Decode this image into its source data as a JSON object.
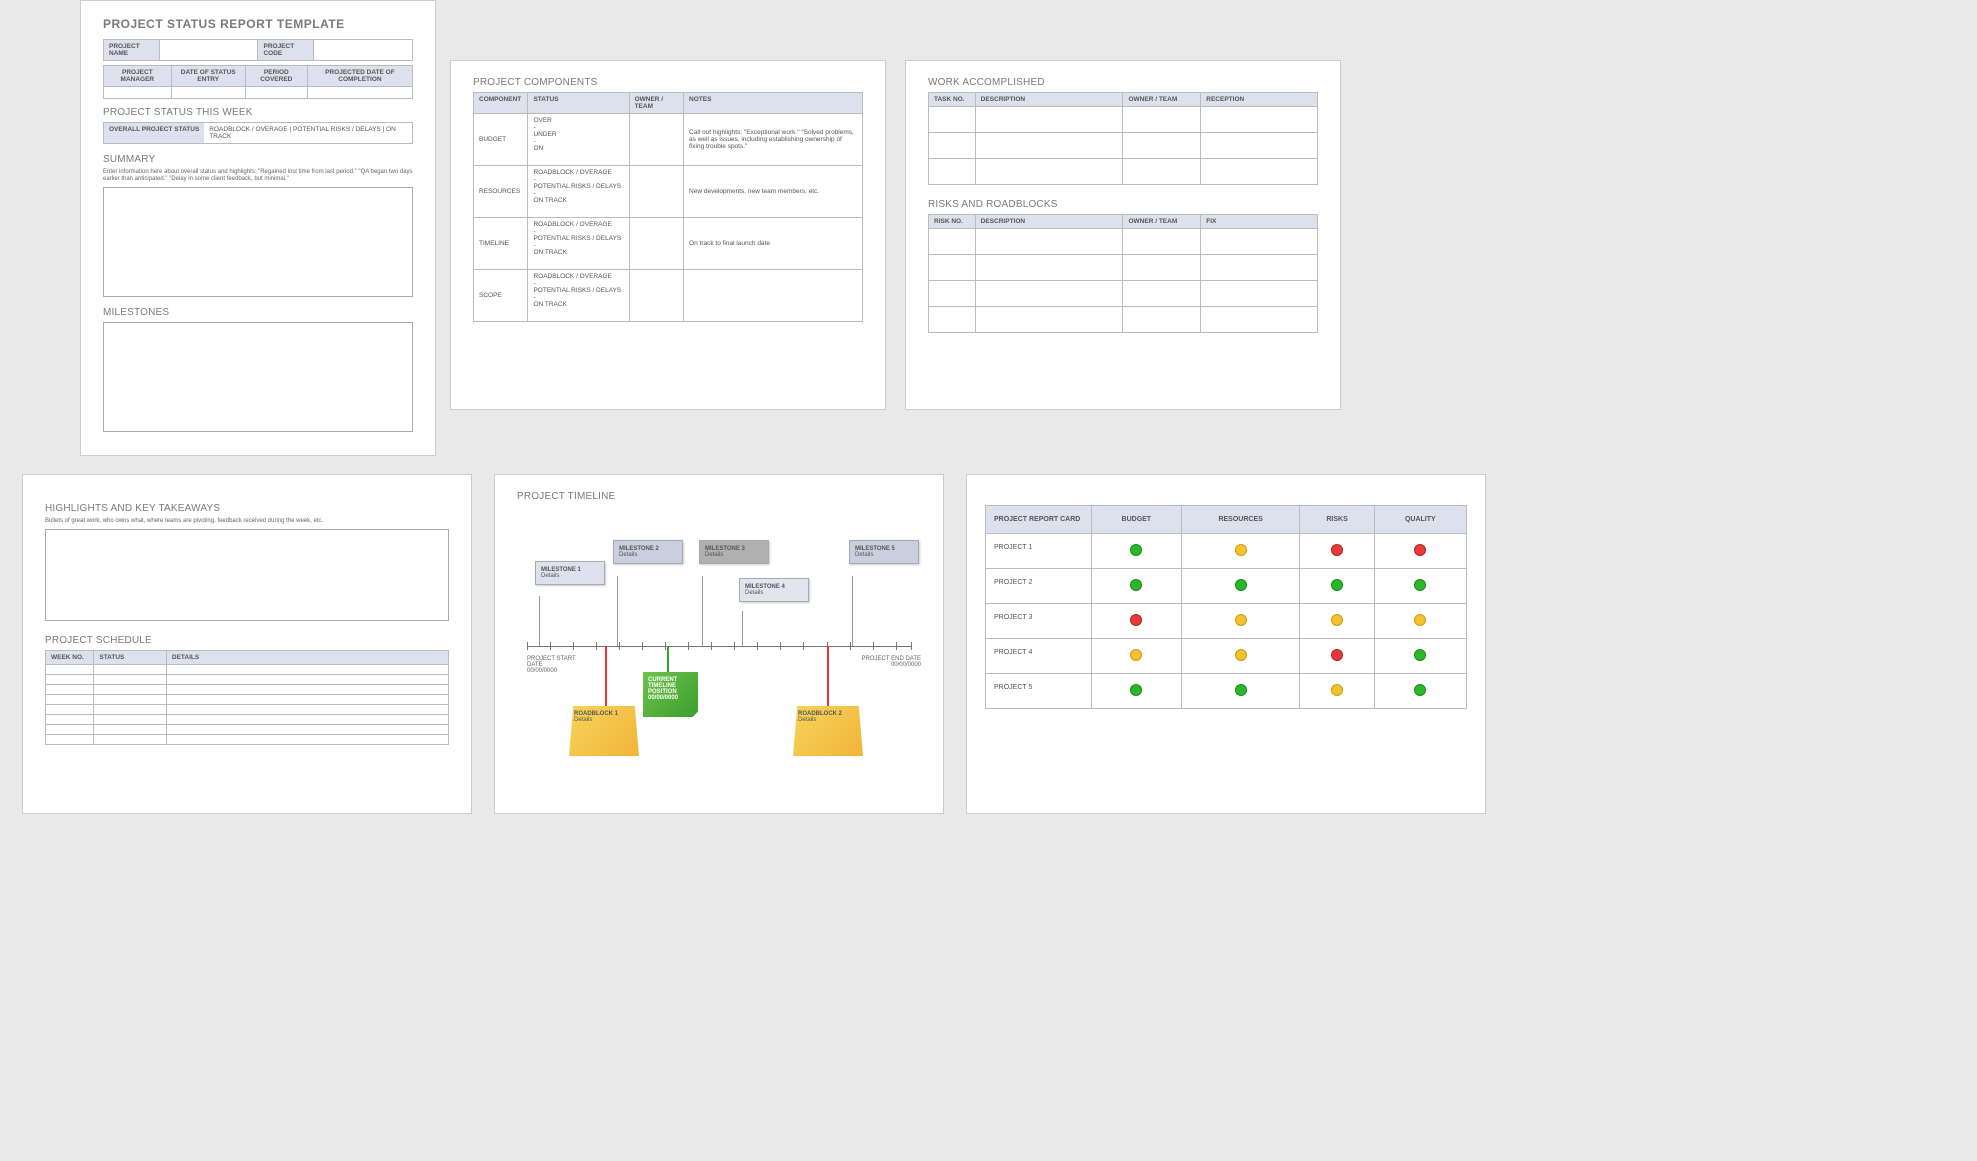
{
  "title": "PROJECT STATUS REPORT TEMPLATE",
  "meta_top": {
    "project_name": "PROJECT NAME",
    "project_code": "PROJECT CODE"
  },
  "meta_row": {
    "pm": "PROJECT MANAGER",
    "date_entry": "DATE OF STATUS ENTRY",
    "period": "PERIOD COVERED",
    "completion": "PROJECTED DATE OF COMPLETION"
  },
  "status_week": {
    "heading": "PROJECT STATUS THIS WEEK",
    "label": "OVERALL PROJECT STATUS",
    "legend": "ROADBLOCK / OVERAGE   |   POTENTIAL RISKS / DELAYS   |   ON TRACK"
  },
  "summary": {
    "heading": "SUMMARY",
    "hint": "Enter information here about overall status and highlights: \"Regained lost time from last period.\" \"QA began two days earlier than anticipated.\" \"Delay in some client feedback, but minimal.\""
  },
  "milestones_heading": "MILESTONES",
  "components": {
    "heading": "PROJECT COMPONENTS",
    "cols": {
      "c0": "COMPONENT",
      "c1": "STATUS",
      "c2": "OWNER / TEAM",
      "c3": "NOTES"
    },
    "rows": [
      {
        "name": "BUDGET",
        "status": "OVER\n-\nUNDER\n-\nON",
        "notes": "Call out highlights: \"Exceptional work.\" \"Solved problems, as well as issues, including establishing ownership of fixing trouble spots.\""
      },
      {
        "name": "RESOURCES",
        "status": "ROADBLOCK / OVERAGE\n-\nPOTENTIAL RISKS / DELAYS\n-\nON TRACK",
        "notes": "New developments, new team members, etc."
      },
      {
        "name": "TIMELINE",
        "status": "ROADBLOCK / OVERAGE\n-\nPOTENTIAL RISKS / DELAYS\n-\nON TRACK",
        "notes": "On track to final launch date"
      },
      {
        "name": "SCOPE",
        "status": "ROADBLOCK / OVERAGE\n-\nPOTENTIAL RISKS / DELAYS\n-\nON TRACK",
        "notes": ""
      }
    ]
  },
  "work": {
    "heading": "WORK ACCOMPLISHED",
    "cols": {
      "c0": "TASK NO.",
      "c1": "DESCRIPTION",
      "c2": "OWNER / TEAM",
      "c3": "RECEPTION"
    }
  },
  "risks": {
    "heading": "RISKS AND ROADBLOCKS",
    "cols": {
      "c0": "RISK NO.",
      "c1": "DESCRIPTION",
      "c2": "OWNER / TEAM",
      "c3": "FIX"
    }
  },
  "highlights": {
    "heading": "HIGHLIGHTS AND KEY TAKEAWAYS",
    "hint": "Bullets of great work, who owns what, where teams are pivoting, feedback received during the week, etc."
  },
  "schedule": {
    "heading": "PROJECT SCHEDULE",
    "cols": {
      "c0": "WEEK NO.",
      "c1": "STATUS",
      "c2": "DETAILS"
    }
  },
  "timeline": {
    "heading": "PROJECT TIMELINE",
    "start_label": "PROJECT START DATE",
    "start_date": "00/00/0000",
    "end_label": "PROJECT END DATE",
    "end_date": "00/00/0000",
    "m1": "MILESTONE 1",
    "m1d": "Details",
    "m2": "MILESTONE 2",
    "m2d": "Details",
    "m3": "MILESTONE 3",
    "m3d": "Details",
    "m4": "MILESTONE 4",
    "m4d": "Details",
    "m5": "MILESTONE 5",
    "m5d": "Details",
    "r1": "ROADBLOCK 1",
    "r1d": "Details",
    "r2": "ROADBLOCK 2",
    "r2d": "Details",
    "cur_l1": "CURRENT",
    "cur_l2": "TIMELINE",
    "cur_l3": "POSITION",
    "cur_date": "00/00/0000"
  },
  "report_card": {
    "row0": "PROJECT REPORT CARD",
    "cols": {
      "c1": "BUDGET",
      "c2": "RESOURCES",
      "c3": "RISKS",
      "c4": "QUALITY"
    },
    "rows": [
      {
        "name": "PROJECT 1",
        "v": [
          "g",
          "y",
          "r",
          "r"
        ]
      },
      {
        "name": "PROJECT 2",
        "v": [
          "g",
          "g",
          "g",
          "g"
        ]
      },
      {
        "name": "PROJECT 3",
        "v": [
          "r",
          "y",
          "y",
          "y"
        ]
      },
      {
        "name": "PROJECT 4",
        "v": [
          "y",
          "y",
          "r",
          "g"
        ]
      },
      {
        "name": "PROJECT 5",
        "v": [
          "g",
          "g",
          "y",
          "g"
        ]
      }
    ]
  }
}
